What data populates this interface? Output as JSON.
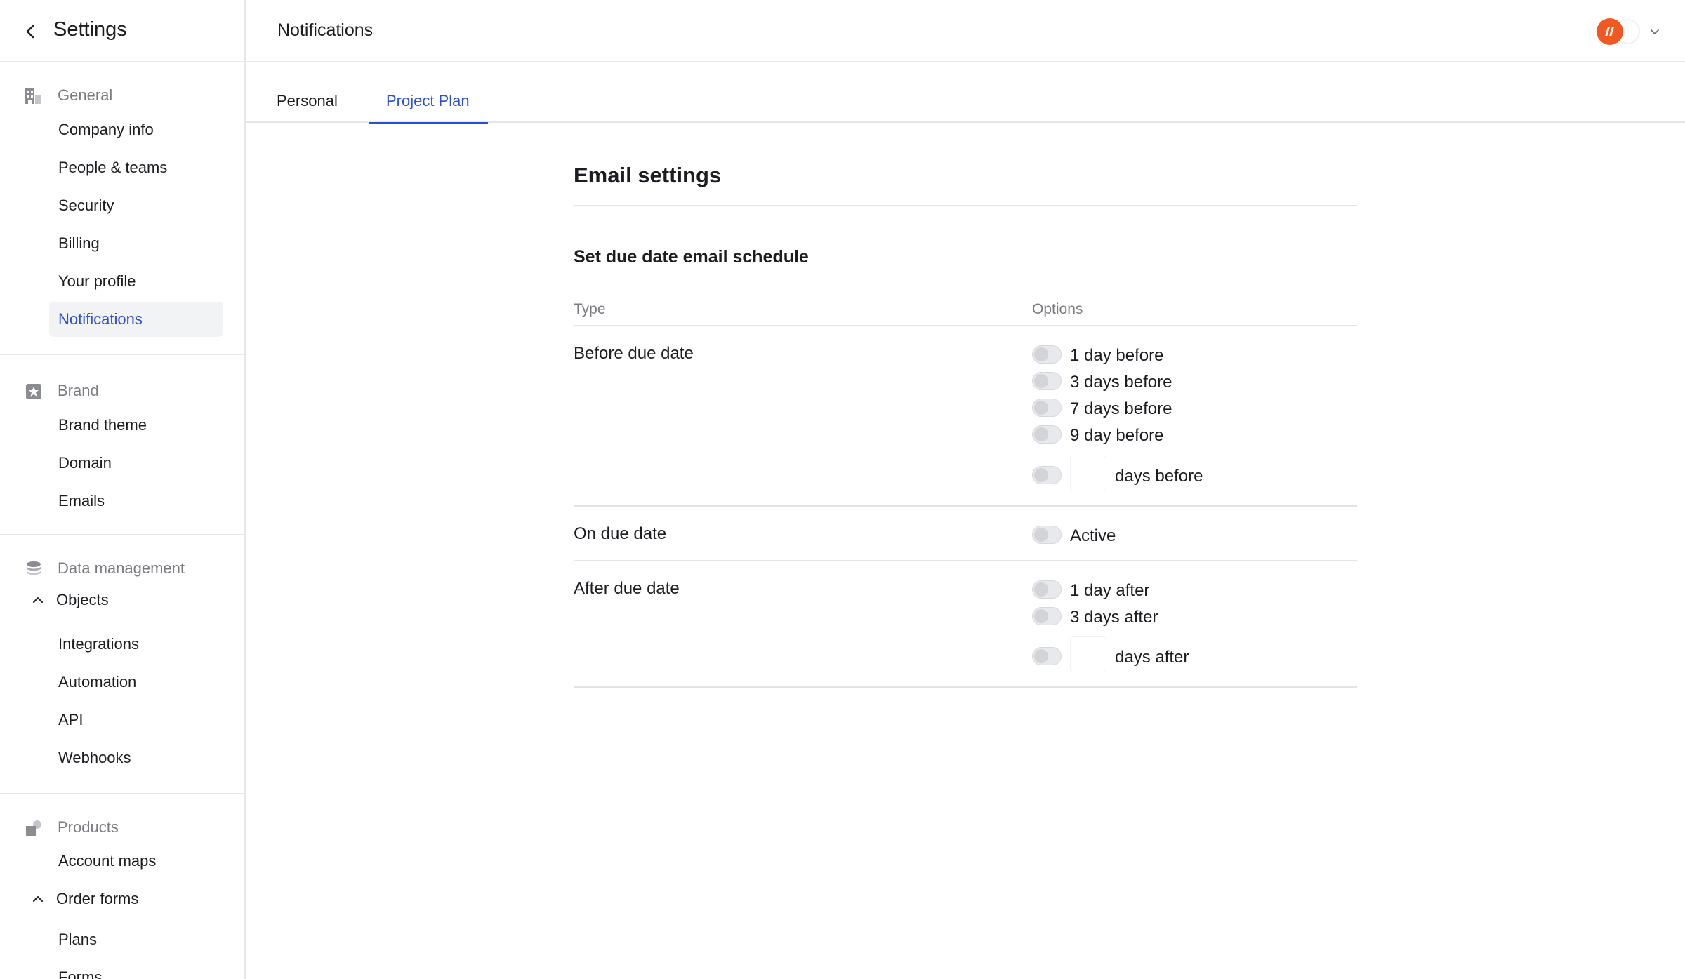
{
  "sidebar": {
    "title": "Settings",
    "sections": [
      {
        "label": "General",
        "icon": "building-icon",
        "items": [
          "Company info",
          "People & teams",
          "Security",
          "Billing",
          "Your profile",
          "Notifications"
        ]
      },
      {
        "label": "Brand",
        "icon": "star-badge-icon",
        "items": [
          "Brand theme",
          "Domain",
          "Emails"
        ]
      },
      {
        "label": "Data management",
        "icon": "database-icon",
        "group": "Objects",
        "items": [
          "Integrations",
          "Automation",
          "API",
          "Webhooks"
        ]
      },
      {
        "label": "Products",
        "icon": "products-icon",
        "items": [
          "Account maps"
        ],
        "group": "Order forms",
        "group_items": [
          "Plans",
          "Forms"
        ]
      }
    ],
    "active_item": "Notifications"
  },
  "header": {
    "title": "Notifications"
  },
  "tabs": [
    {
      "label": "Personal",
      "active": false
    },
    {
      "label": "Project Plan",
      "active": true
    }
  ],
  "content": {
    "title": "Email settings",
    "subtitle": "Set due date email schedule",
    "columns": {
      "type": "Type",
      "options": "Options"
    },
    "rows": [
      {
        "label": "Before due date",
        "options": [
          "1 day before",
          "3 days before",
          "7 days before",
          "9 day before"
        ],
        "custom": {
          "value": "",
          "suffix": "days before"
        }
      },
      {
        "label": "On due date",
        "options": [
          "Active"
        ]
      },
      {
        "label": "After due date",
        "options": [
          "1 day after",
          "3 days after"
        ],
        "custom": {
          "value": "",
          "suffix": "days after"
        }
      }
    ]
  },
  "colors": {
    "accent": "#2d4fd6",
    "avatar": "#f05a22",
    "border": "#e6e7ea",
    "muted_text": "#7a7c82"
  }
}
